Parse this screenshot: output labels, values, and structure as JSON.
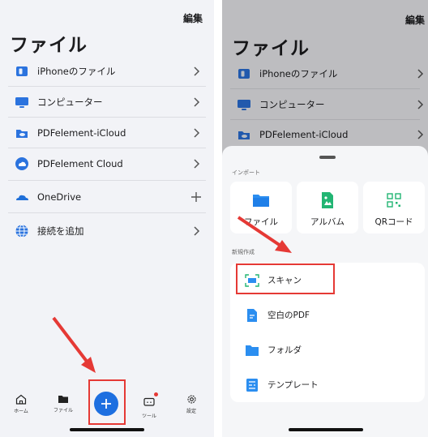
{
  "left": {
    "edit_label": "編集",
    "title": "ファイル",
    "rows": [
      {
        "label": "iPhoneのファイル",
        "icon": "iphone-folder-icon"
      },
      {
        "label": "コンピューター",
        "icon": "computer-icon"
      },
      {
        "label": "PDFelement-iCloud",
        "icon": "icloud-folder-icon"
      },
      {
        "label": "PDFelement Cloud",
        "icon": "pdfelement-cloud-icon"
      },
      {
        "label": "OneDrive",
        "icon": "onedrive-icon"
      },
      {
        "label": "接続を追加",
        "icon": "globe-icon"
      }
    ],
    "tabs": [
      {
        "label": "ホーム",
        "icon": "home-icon"
      },
      {
        "label": "ファイル",
        "icon": "folder-icon"
      },
      {
        "label": "ツール",
        "icon": "toolbox-icon"
      },
      {
        "label": "設定",
        "icon": "gear-icon"
      }
    ]
  },
  "right": {
    "edit_label": "編集",
    "title": "ファイル",
    "rows": [
      {
        "label": "iPhoneのファイル"
      },
      {
        "label": "コンピューター"
      },
      {
        "label": "PDFelement-iCloud"
      }
    ],
    "import_section": "インポート",
    "import_items": [
      {
        "label": "ファイル",
        "icon": "folder-icon"
      },
      {
        "label": "アルバム",
        "icon": "album-icon"
      },
      {
        "label": "QRコード",
        "icon": "qr-code-icon"
      }
    ],
    "create_section": "新規作成",
    "create_items": [
      {
        "label": "スキャン",
        "icon": "scan-icon"
      },
      {
        "label": "空白のPDF",
        "icon": "blank-pdf-icon"
      },
      {
        "label": "フォルダ",
        "icon": "folder-icon"
      },
      {
        "label": "テンプレート",
        "icon": "template-icon"
      }
    ]
  },
  "colors": {
    "accent": "#1d6fe0",
    "highlight": "#e53935",
    "background": "#f2f3f7"
  }
}
